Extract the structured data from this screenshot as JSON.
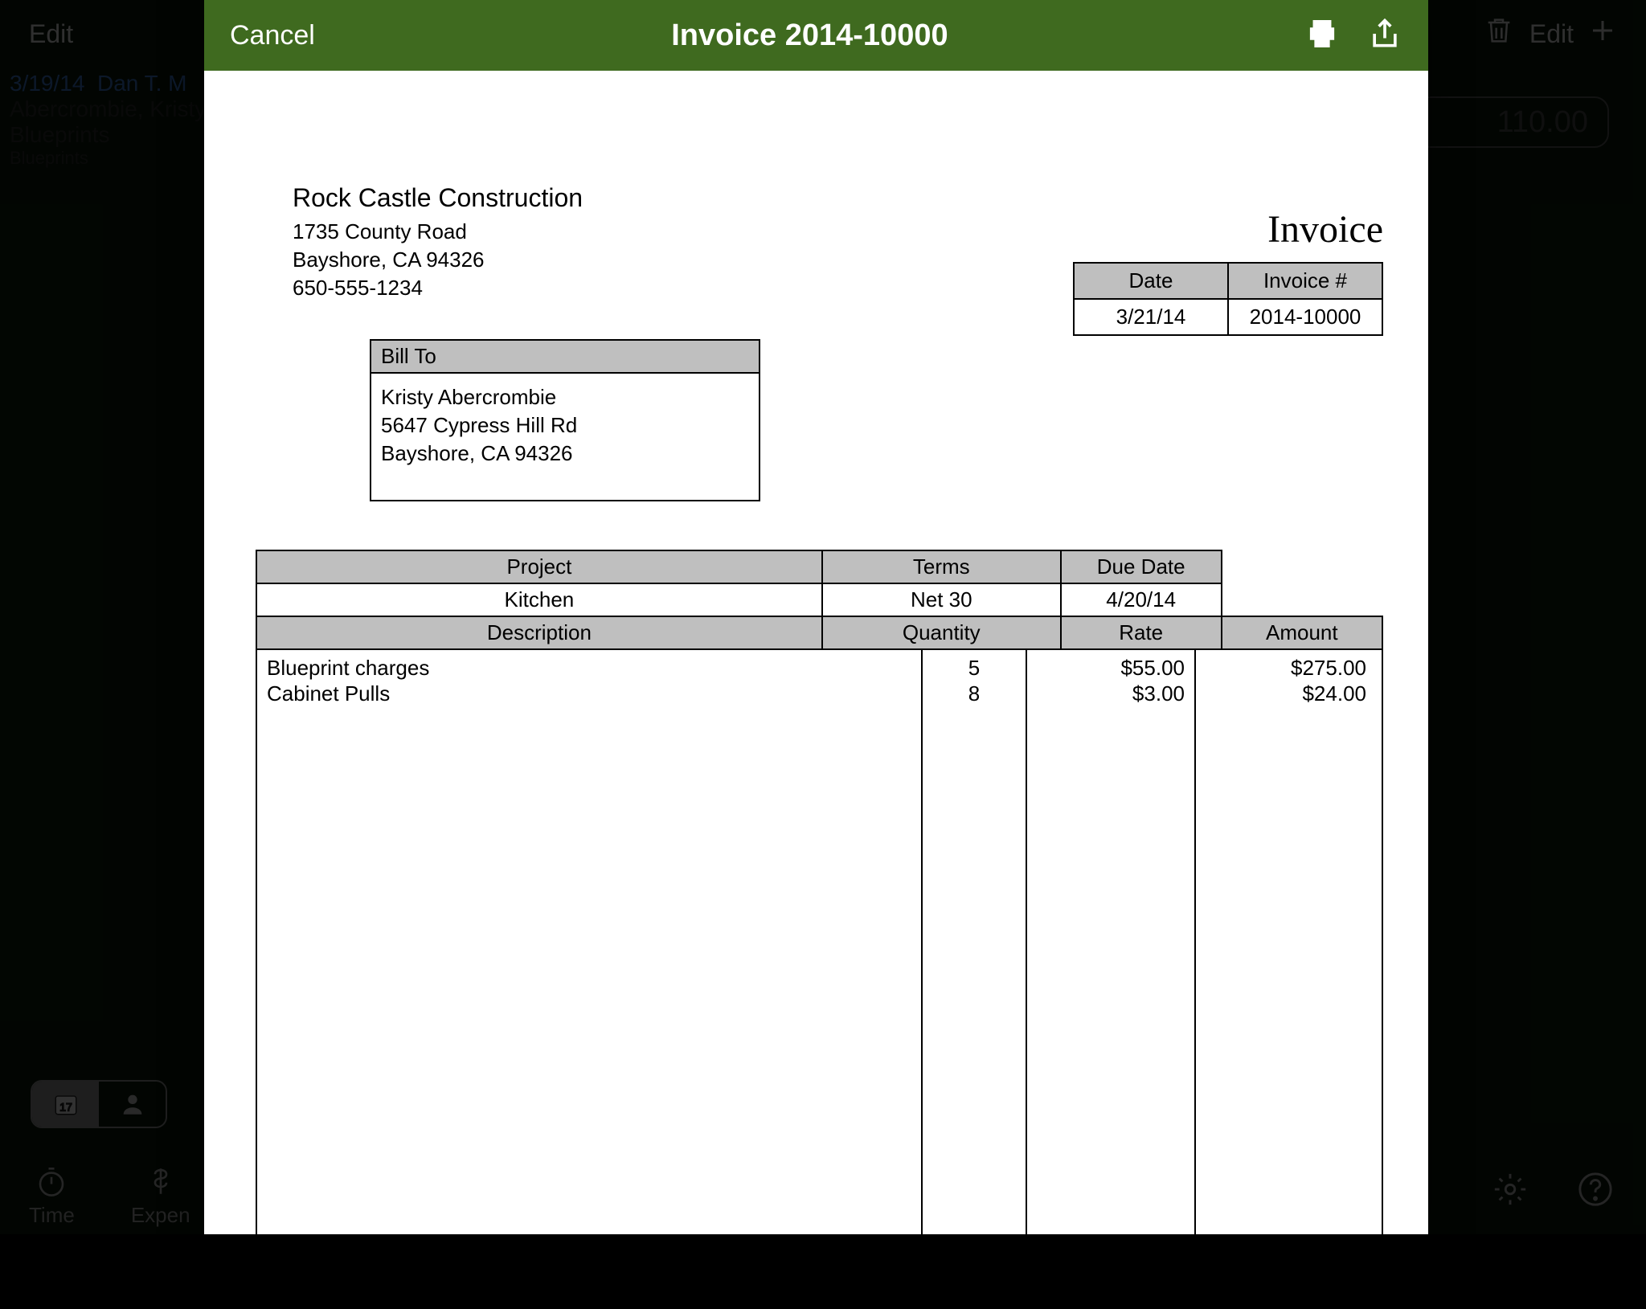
{
  "background": {
    "edit_left": "Edit",
    "edit_right": "Edit",
    "list_date": "3/19/14",
    "list_name": "Dan T. M",
    "list_customer": "Abercrombie, Kristy",
    "list_item": "Blueprints",
    "list_sub": "Blueprints",
    "pill_amount": "110.00",
    "tab_time": "Time",
    "tab_expen": "Expen"
  },
  "modal": {
    "cancel": "Cancel",
    "title": "Invoice 2014-10000"
  },
  "invoice": {
    "company_name": "Rock Castle Construction",
    "company_addr1": "1735 County Road",
    "company_addr2": "Bayshore, CA 94326",
    "company_phone": "650-555-1234",
    "doc_label": "Invoice",
    "meta": {
      "date_h": "Date",
      "num_h": "Invoice #",
      "date": "3/21/14",
      "num": "2014-10000"
    },
    "billto_h": "Bill To",
    "billto_name": "Kristy Abercrombie",
    "billto_addr1": "5647 Cypress Hill Rd",
    "billto_addr2": "Bayshore, CA 94326",
    "proj": {
      "project_h": "Project",
      "terms_h": "Terms",
      "due_h": "Due Date",
      "project": "Kitchen",
      "terms": "Net 30",
      "due": "4/20/14"
    },
    "items_h": {
      "desc": "Description",
      "qty": "Quantity",
      "rate": "Rate",
      "amt": "Amount"
    },
    "items": [
      {
        "desc": "Blueprint charges",
        "qty": "5",
        "rate": "$55.00",
        "amt": "$275.00"
      },
      {
        "desc": "Cabinet Pulls",
        "qty": "8",
        "rate": "$3.00",
        "amt": "$24.00"
      }
    ]
  }
}
